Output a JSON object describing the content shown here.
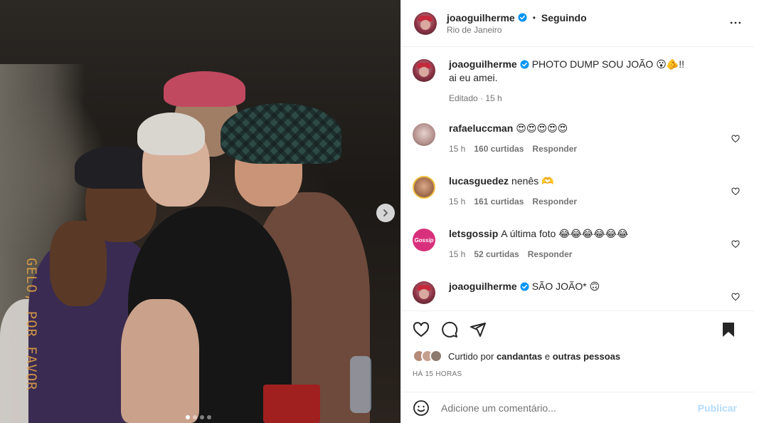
{
  "post": {
    "username": "joaoguilherme",
    "follow_status": "Seguindo",
    "separator": "•",
    "location": "Rio de Janeiro",
    "more_icon": "more-horizontal-icon",
    "film_stamp": "GELO, POR FAVOR",
    "carousel": {
      "total": 4,
      "current": 1
    }
  },
  "caption": {
    "username": "joaoguilherme",
    "text_line1": "PHOTO DUMP SOU JOÃO 😮🫵!!",
    "text_line2": "ai eu amei.",
    "meta": "Editado · 15 h"
  },
  "comments": [
    {
      "username": "rafaeluccman",
      "text": "😍😍😍😍😍",
      "time": "15 h",
      "likes": "160 curtidas",
      "reply": "Responder"
    },
    {
      "username": "lucasguedez",
      "text": "nenês 🫶",
      "time": "15 h",
      "likes": "161 curtidas",
      "reply": "Responder"
    },
    {
      "username": "letsgossip",
      "text": "A última foto 😂😂😂😂😂😂",
      "time": "15 h",
      "likes": "52 curtidas",
      "reply": "Responder",
      "avatar_label": "Gossip"
    },
    {
      "username": "joaoguilherme",
      "text": "SÃO JOÃO* 🙃"
    }
  ],
  "likes": {
    "prefix": "Curtido por",
    "user": "candantas",
    "conjunction": "e",
    "others": "outras pessoas"
  },
  "timestamp": "HÁ 15 HORAS",
  "add_comment": {
    "placeholder": "Adicione um comentário...",
    "publish": "Publicar"
  },
  "colors": {
    "verified": "#0095f6",
    "publish_disabled": "#b3dbff",
    "secondary_text": "#737373"
  }
}
